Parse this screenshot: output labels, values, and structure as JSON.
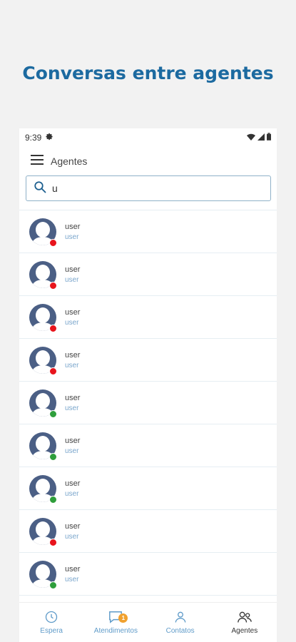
{
  "promo": {
    "title": "Conversas entre agentes"
  },
  "status_bar": {
    "time": "9:39"
  },
  "app_bar": {
    "title": "Agentes",
    "menu_icon": "hamburger-menu-icon"
  },
  "search": {
    "value": "u",
    "placeholder": ""
  },
  "agents": [
    {
      "name": "user",
      "subtitle": "user",
      "status": "offline"
    },
    {
      "name": "user",
      "subtitle": "user",
      "status": "offline"
    },
    {
      "name": "user",
      "subtitle": "user",
      "status": "offline"
    },
    {
      "name": "user",
      "subtitle": "user",
      "status": "offline"
    },
    {
      "name": "user",
      "subtitle": "user",
      "status": "online"
    },
    {
      "name": "user",
      "subtitle": "user",
      "status": "online"
    },
    {
      "name": "user",
      "subtitle": "user",
      "status": "online"
    },
    {
      "name": "user",
      "subtitle": "user",
      "status": "offline"
    },
    {
      "name": "user",
      "subtitle": "user",
      "status": "online"
    }
  ],
  "status_colors": {
    "online": "#2e9e3b",
    "offline": "#e8141c"
  },
  "bottom_nav": {
    "items": [
      {
        "label": "Espera",
        "icon": "clock-icon",
        "active": false
      },
      {
        "label": "Atendimentos",
        "icon": "chat-icon",
        "active": false,
        "badge": "1"
      },
      {
        "label": "Contatos",
        "icon": "person-icon",
        "active": false
      },
      {
        "label": "Agentes",
        "icon": "people-icon",
        "active": true
      }
    ]
  }
}
